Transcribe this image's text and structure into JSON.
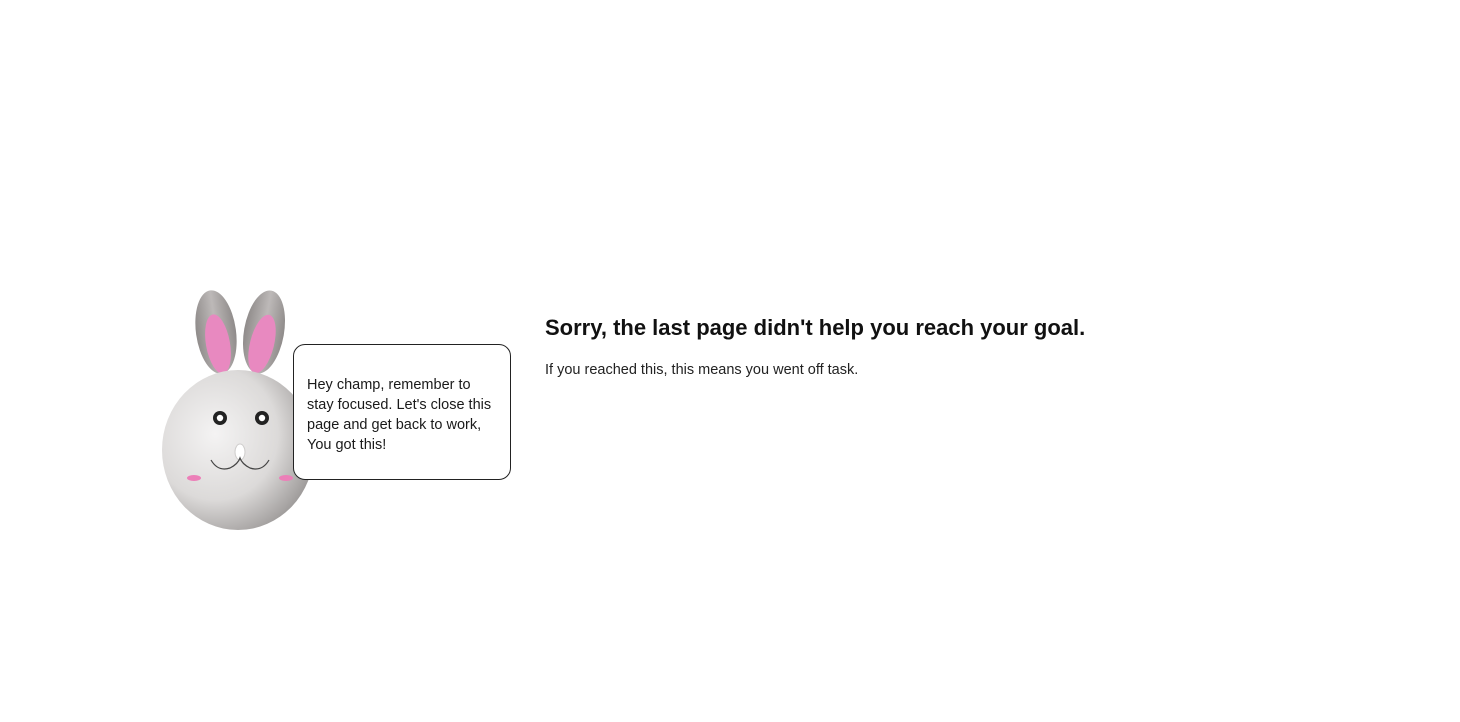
{
  "bubble": {
    "message": "Hey champ, remember to stay focused. Let's close this page and get back to work, You got this!"
  },
  "main": {
    "heading": "Sorry, the last page didn't help you reach your goal.",
    "subtext": "If you reached this, this means you went off task."
  },
  "colors": {
    "ear_inner": "#e889c0",
    "ear_outer": "#a8a4a4",
    "blush": "#ec7fb8",
    "face_light": "#f2f1f1",
    "face_dark": "#9a9897"
  },
  "icons": {
    "mascot": "bunny-icon"
  }
}
